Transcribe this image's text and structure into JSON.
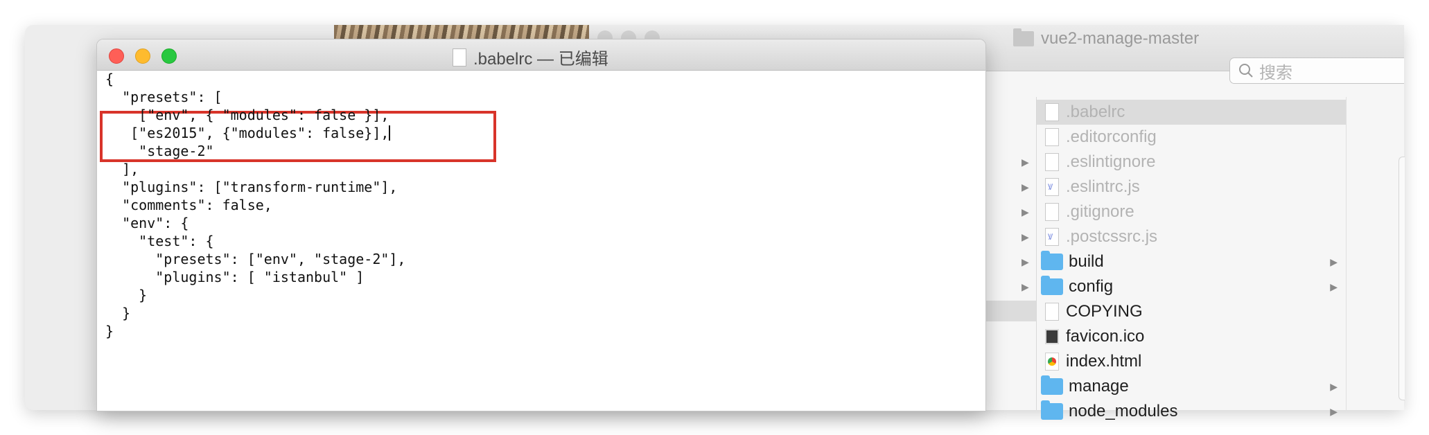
{
  "textedit": {
    "title": ".babelrc — 已编辑",
    "code_lines": [
      "{",
      "  \"presets\": [",
      "    [\"env\", { \"modules\": false }],",
      "   [\"es2015\", {\"modules\": false}],",
      "    \"stage-2\"",
      "  ],",
      "  \"plugins\": [\"transform-runtime\"],",
      "  \"comments\": false,",
      "  \"env\": {",
      "    \"test\": {",
      "      \"presets\": [\"env\", \"stage-2\"],",
      "      \"plugins\": [ \"istanbul\" ]",
      "    }",
      "  }",
      "}"
    ],
    "annotation_color": "#d8342a"
  },
  "finder": {
    "title": "vue2-manage-master",
    "search_placeholder": "搜索",
    "files": [
      {
        "name": ".babelrc",
        "kind": "file",
        "selected": true,
        "dim": true,
        "disclosure": false,
        "chevron": false
      },
      {
        "name": ".editorconfig",
        "kind": "file",
        "selected": false,
        "dim": true,
        "disclosure": false,
        "chevron": false
      },
      {
        "name": ".eslintignore",
        "kind": "file",
        "selected": false,
        "dim": true,
        "disclosure": true,
        "chevron": false
      },
      {
        "name": ".eslintrc.js",
        "kind": "js",
        "selected": false,
        "dim": true,
        "disclosure": true,
        "chevron": false
      },
      {
        "name": ".gitignore",
        "kind": "file",
        "selected": false,
        "dim": true,
        "disclosure": true,
        "chevron": false
      },
      {
        "name": ".postcssrc.js",
        "kind": "js",
        "selected": false,
        "dim": true,
        "disclosure": true,
        "chevron": false
      },
      {
        "name": "build",
        "kind": "folder",
        "selected": false,
        "dim": false,
        "disclosure": true,
        "chevron": true
      },
      {
        "name": "config",
        "kind": "folder",
        "selected": false,
        "dim": false,
        "disclosure": true,
        "chevron": true
      },
      {
        "name": "COPYING",
        "kind": "file",
        "selected": false,
        "dim": false,
        "disclosure": false,
        "chevron": false
      },
      {
        "name": "favicon.ico",
        "kind": "ico",
        "selected": false,
        "dim": false,
        "disclosure": false,
        "chevron": false
      },
      {
        "name": "index.html",
        "kind": "html",
        "selected": false,
        "dim": false,
        "disclosure": false,
        "chevron": false
      },
      {
        "name": "manage",
        "kind": "folder",
        "selected": false,
        "dim": false,
        "disclosure": false,
        "chevron": true
      },
      {
        "name": "node_modules",
        "kind": "folder",
        "selected": false,
        "dim": false,
        "disclosure": false,
        "chevron": true
      }
    ],
    "colors": {
      "folder": "#5fb6ef",
      "selection": "#dcdcdc"
    }
  }
}
